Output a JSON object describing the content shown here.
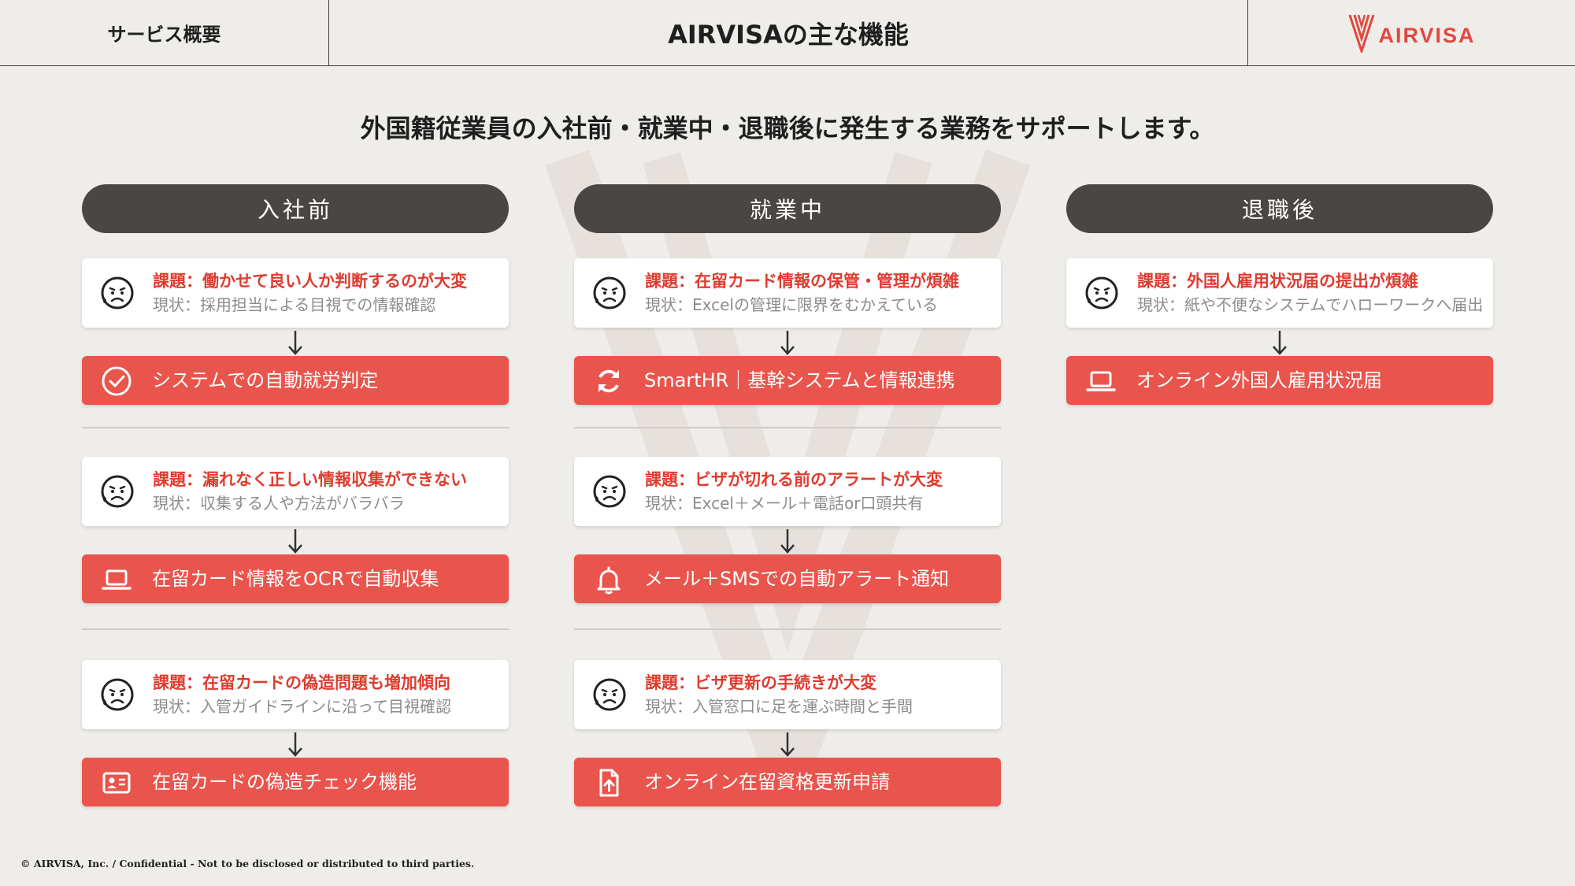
{
  "header": {
    "section": "サービス概要",
    "title": "AIRVISAの主な機能",
    "logo_text": "AIRVISA"
  },
  "subtitle": "外国籍従業員の入社前・就業中・退職後に発生する業務をサポートします。",
  "colors": {
    "accent": "#e9554d",
    "issue_text": "#df3c2f",
    "pill": "#4a4644",
    "background": "#efedea"
  },
  "columns": [
    {
      "title": "入社前",
      "groups": [
        {
          "issue": "課題：働かせて良い人か判断するのが大変",
          "status": "現状：採用担当による目視での情報確認",
          "solution": "システムでの自動就労判定",
          "icon": "check-circle-icon"
        },
        {
          "issue": "課題：漏れなく正しい情報収集ができない",
          "status": "現状：収集する人や方法がバラバラ",
          "solution": "在留カード情報をOCRで自動収集",
          "icon": "laptop-icon"
        },
        {
          "issue": "課題：在留カードの偽造問題も増加傾向",
          "status": "現状：入管ガイドラインに沿って目視確認",
          "solution": "在留カードの偽造チェック機能",
          "icon": "id-card-icon"
        }
      ]
    },
    {
      "title": "就業中",
      "groups": [
        {
          "issue": "課題：在留カード情報の保管・管理が煩雑",
          "status": "現状：Excelの管理に限界をむかえている",
          "solution": "SmartHR｜基幹システムと情報連携",
          "icon": "sync-icon"
        },
        {
          "issue": "課題：ビザが切れる前のアラートが大変",
          "status": "現状：Excel＋メール＋電話or口頭共有",
          "solution": "メール＋SMSでの自動アラート通知",
          "icon": "bell-icon"
        },
        {
          "issue": "課題：ビザ更新の手続きが大変",
          "status": "現状：入管窓口に足を運ぶ時間と手間",
          "solution": "オンライン在留資格更新申請",
          "icon": "file-upload-icon"
        }
      ]
    },
    {
      "title": "退職後",
      "groups": [
        {
          "issue": "課題：外国人雇用状況届の提出が煩雑",
          "status": "現状：紙や不便なシステムでハローワークへ届出",
          "solution": "オンライン外国人雇用状況届",
          "icon": "laptop-icon"
        }
      ]
    }
  ],
  "footer": "© AIRVISA, Inc. / Confidential - Not to be disclosed or distributed to third parties."
}
